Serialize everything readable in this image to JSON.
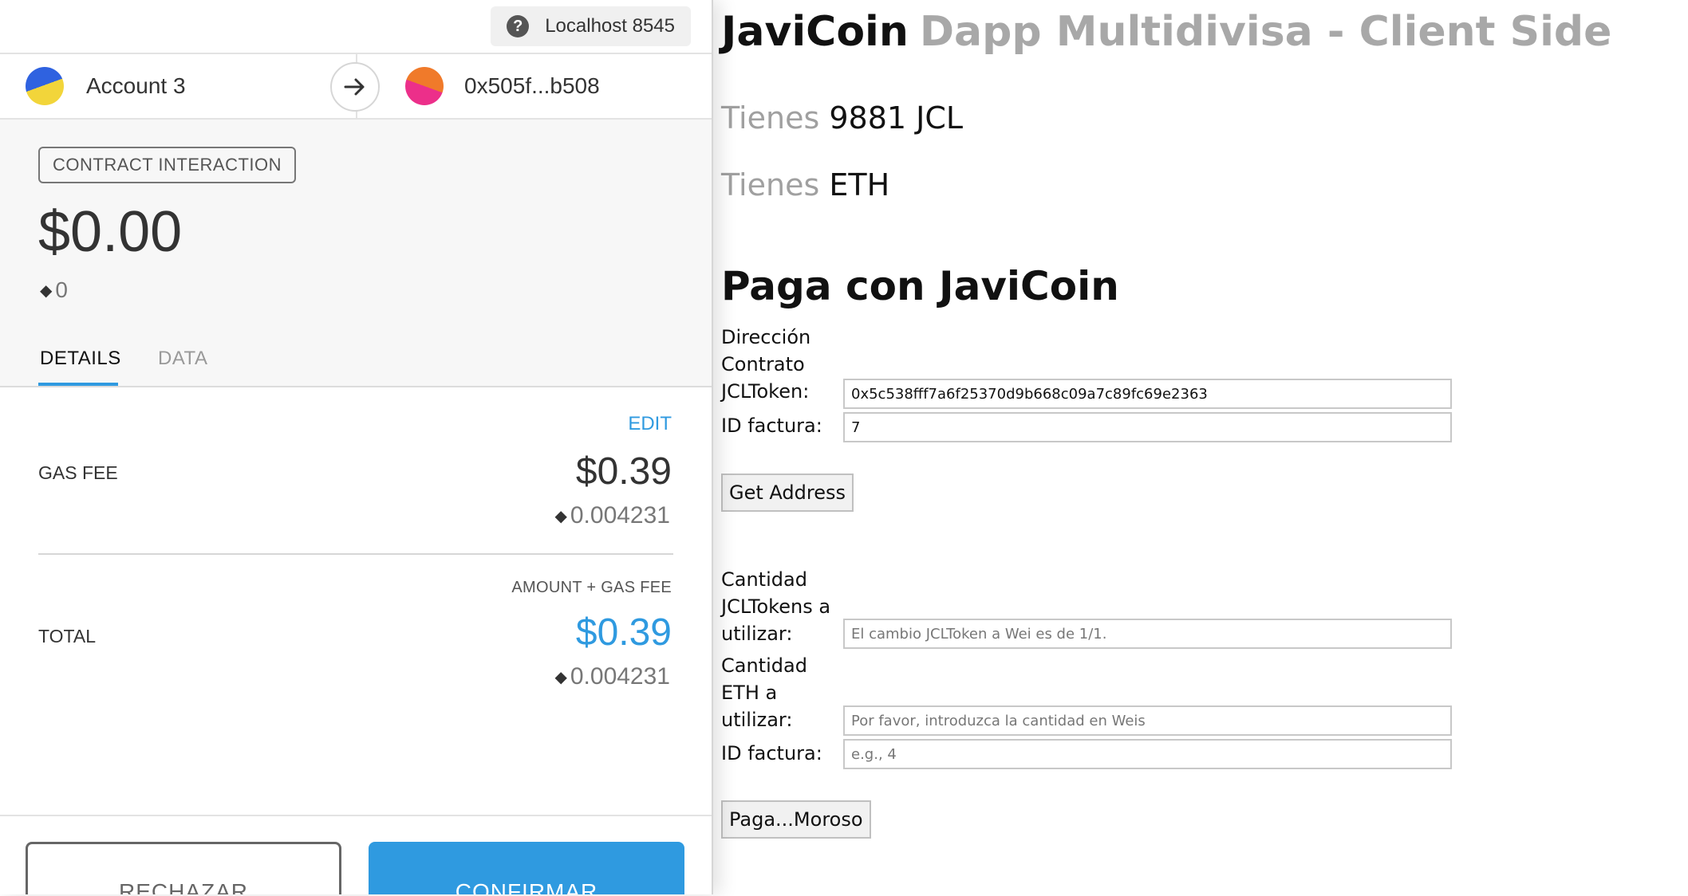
{
  "metamask": {
    "network": "Localhost 8545",
    "from_account": "Account 3",
    "to_address": "0x505f...b508",
    "tag": "CONTRACT INTERACTION",
    "amount_usd": "$0.00",
    "amount_eth": "0",
    "tabs": [
      "DETAILS",
      "DATA"
    ],
    "edit_label": "EDIT",
    "gas_fee_label": "GAS FEE",
    "gas_fee_usd": "$0.39",
    "gas_fee_eth": "0.004231",
    "amount_gas_label": "AMOUNT + GAS FEE",
    "total_label": "TOTAL",
    "total_usd": "$0.39",
    "total_eth": "0.004231",
    "reject_label": "RECHAZAR",
    "confirm_label": "CONFIRMAR",
    "accent_color": "#2f9ae0"
  },
  "dapp": {
    "brand": "JaviCoin",
    "subtitle": "Dapp Multidivisa - Client Side",
    "balance1_label": "Tienes",
    "balance1_value": "9881 JCL",
    "balance2_label": "Tienes",
    "balance2_value": "ETH",
    "pay_title": "Paga con JaviCoin",
    "contract_label": "Dirección Contrato JCLToken:",
    "contract_value": "0x5c538fff7a6f25370d9b668c09a7c89fc69e2363",
    "invoice_label": "ID factura:",
    "invoice_value": "7",
    "get_address_button": "Get Address",
    "jcl_amount_label": "Cantidad JCLTokens a utilizar:",
    "jcl_amount_placeholder": "El cambio JCLToken a Wei es de 1/1.",
    "eth_amount_label": "Cantidad ETH a utilizar:",
    "eth_amount_placeholder": "Por favor, introduzca la cantidad en Weis",
    "invoice2_label": "ID factura:",
    "invoice2_placeholder": "e.g., 4",
    "pay_button": "Paga...Moroso"
  }
}
